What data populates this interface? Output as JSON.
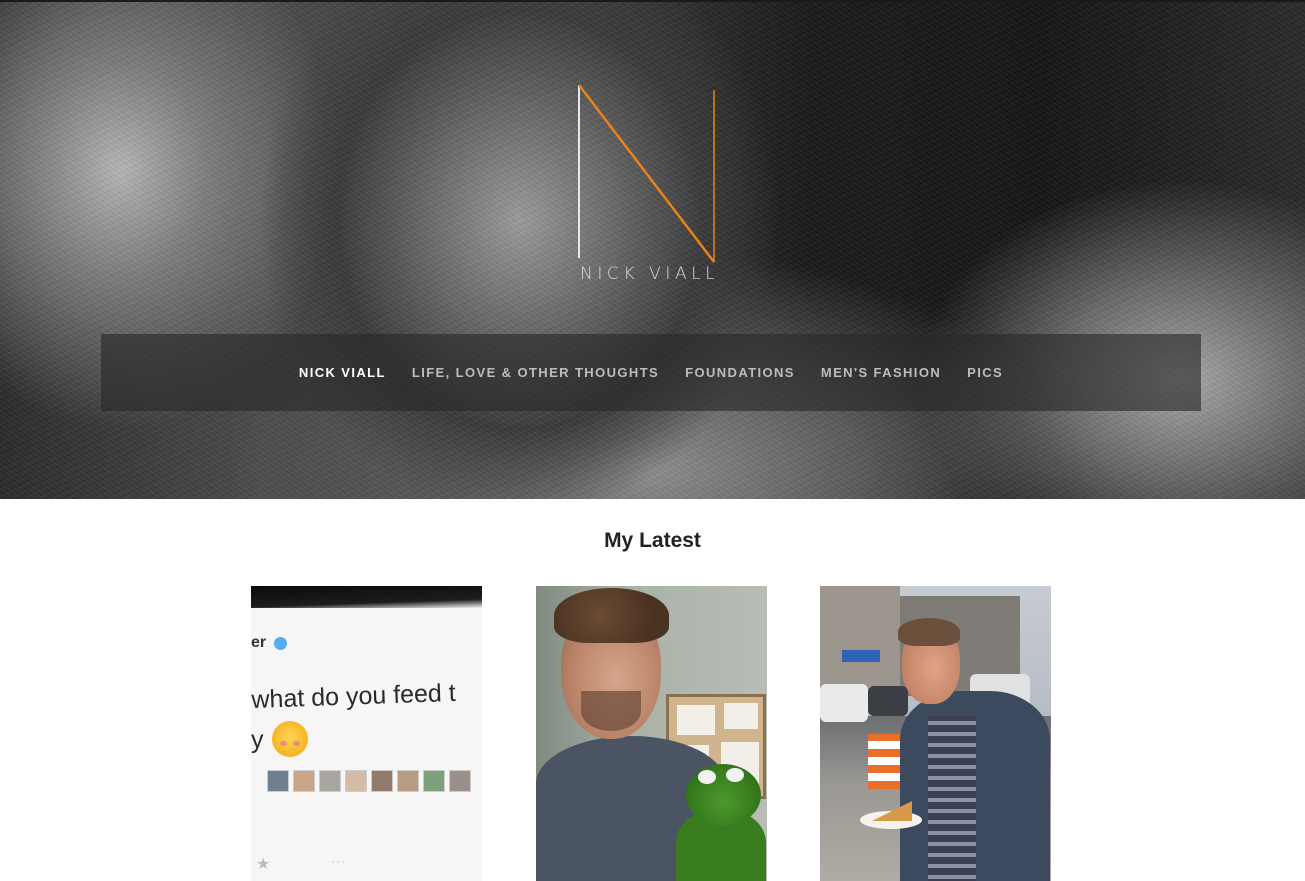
{
  "site": {
    "logo_text": "NICK VIALL",
    "logo_colors": {
      "line_white": "#e8e8e8",
      "line_orange": "#e8821a"
    }
  },
  "nav": {
    "items": [
      {
        "label": "NICK VIALL",
        "active": true
      },
      {
        "label": "LIFE, LOVE & OTHER THOUGHTS",
        "active": false
      },
      {
        "label": "FOUNDATIONS",
        "active": false
      },
      {
        "label": "MEN'S FASHION",
        "active": false
      },
      {
        "label": "PICS",
        "active": false
      }
    ]
  },
  "latest": {
    "title": "My Latest",
    "cards": [
      {
        "kind": "tweet-screenshot",
        "handle_fragment": "er",
        "text_line1": "what do you feed t",
        "text_line2": "y"
      },
      {
        "kind": "photo-with-kermit"
      },
      {
        "kind": "photo-street-pizza"
      }
    ]
  },
  "colors": {
    "accent": "#e8821a",
    "nav_bg": "rgba(40,40,40,0.62)",
    "title": "#222222"
  }
}
